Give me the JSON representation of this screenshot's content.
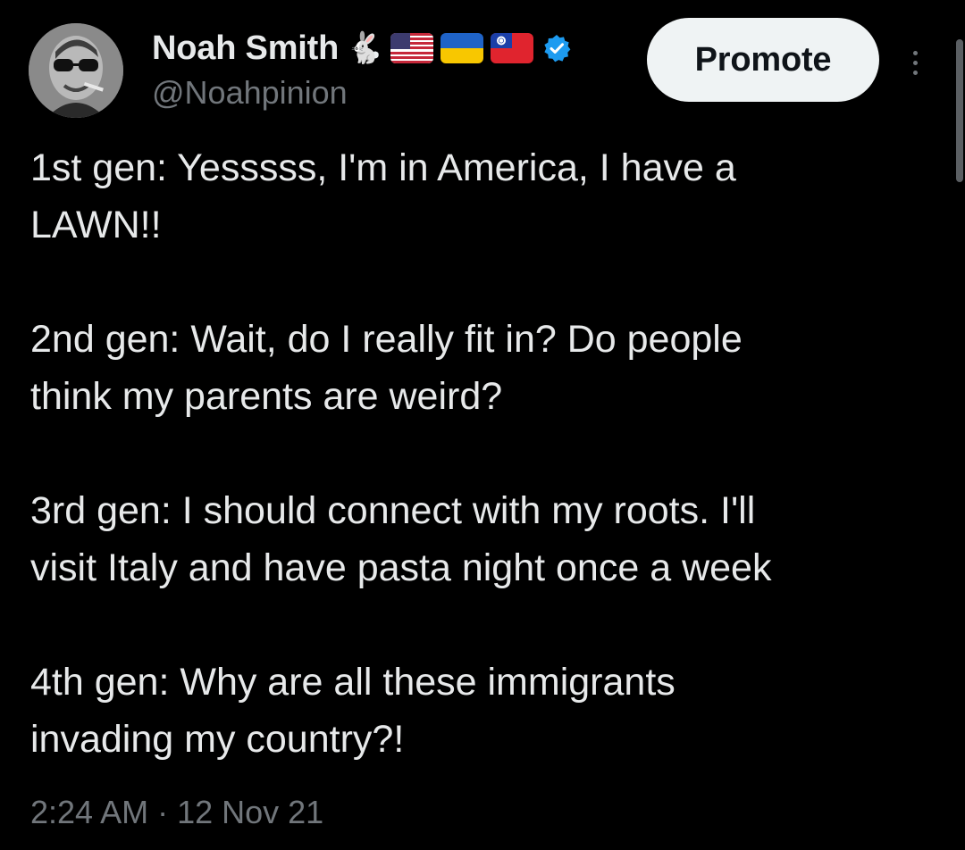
{
  "author": {
    "display_name": "Noah Smith",
    "handle": "@Noahpinion",
    "name_emoji": [
      "rabbit-icon",
      "us-flag-icon",
      "ukraine-flag-icon",
      "taiwan-flag-icon"
    ],
    "verified": true
  },
  "actions": {
    "promote_label": "Promote"
  },
  "tweet": {
    "paragraphs": [
      "1st gen: Yesssss, I'm in America, I have a\nLAWN!!",
      "2nd gen: Wait, do I really fit in? Do people\nthink my parents are weird?",
      "3rd gen: I should connect with my roots. I'll\nvisit Italy and have pasta night once a week",
      "4th gen: Why are all these immigrants\ninvading my country?!"
    ],
    "timestamp": "2:24 AM · 12 Nov 21"
  },
  "colors": {
    "background": "#000000",
    "primary_text": "#e7e9ea",
    "secondary_text": "#71767b",
    "verified_blue": "#1d9bf0",
    "promote_bg": "#eff3f4"
  }
}
